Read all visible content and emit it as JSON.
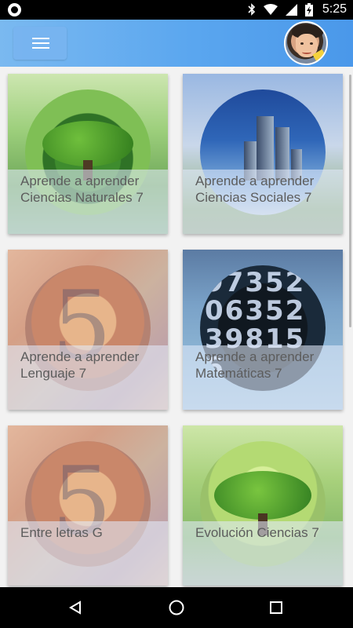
{
  "status_bar": {
    "time": "5:25",
    "battery_level": "charging"
  },
  "app_bar": {
    "menu_icon": "hamburger-menu-icon",
    "avatar_icon": "user-avatar"
  },
  "courses": [
    {
      "title": "Aprende a aprender Ciencias Naturales 7",
      "image": "tree-image"
    },
    {
      "title": "Aprende a aprender Ciencias Sociales 7",
      "image": "city-image"
    },
    {
      "title": "Aprende a aprender Lenguaje 7",
      "image": "letter-image"
    },
    {
      "title": "Aprende a aprender Matemáticas 7",
      "image": "numbers-image"
    },
    {
      "title": "Entre letras G",
      "image": "letter-image"
    },
    {
      "title": "Evolución Ciencias 7",
      "image": "tree-image"
    }
  ],
  "nav_bar": {
    "back_icon": "back-triangle-icon",
    "home_icon": "home-circle-icon",
    "recent_icon": "recent-square-icon"
  },
  "colors": {
    "app_bar_start": "#7ab9f0",
    "app_bar_end": "#4a98ea",
    "caption_text": "#5c5c5c"
  }
}
